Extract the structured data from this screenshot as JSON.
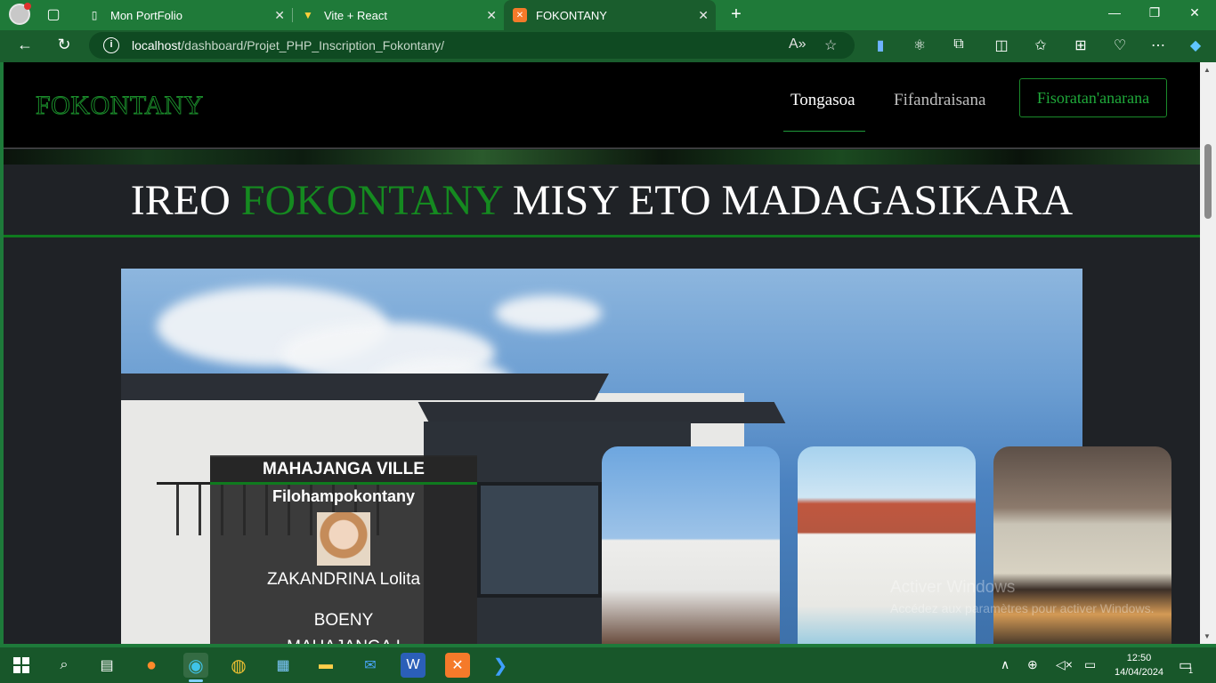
{
  "browser": {
    "tabs": [
      {
        "title": "Mon PortFolio",
        "icon": "page-icon",
        "active": false
      },
      {
        "title": "Vite + React",
        "icon": "vite-icon",
        "active": false
      },
      {
        "title": "FOKONTANY",
        "icon": "xampp-icon",
        "active": true
      }
    ],
    "url_host": "localhost",
    "url_path": "/dashboard/Projet_PHP_Inscription_Fokontany/",
    "accent_color": "#1f7a39"
  },
  "site": {
    "brand": "FOKONTANY",
    "nav": {
      "home": "Tongasoa",
      "contact": "Fifandraisana",
      "register": "Fisoratan'anarana"
    },
    "hero_title": {
      "part1": "IREO ",
      "accent": "FOKONTANY",
      "part2": " MISY ETO MADAGASIKARA"
    },
    "card": {
      "city": "MAHAJANGA VILLE",
      "role": "Filohampokontany",
      "person": "ZAKANDRINA Lolita",
      "region": "BOENY",
      "district": "MAHAJANGA I"
    },
    "accent_color": "#158a20"
  },
  "watermark": {
    "line1": "Activer Windows",
    "line2": "Accédez aux paramètres pour activer Windows."
  },
  "taskbar": {
    "time": "12:50",
    "date": "14/04/2024",
    "notifications": "1"
  }
}
